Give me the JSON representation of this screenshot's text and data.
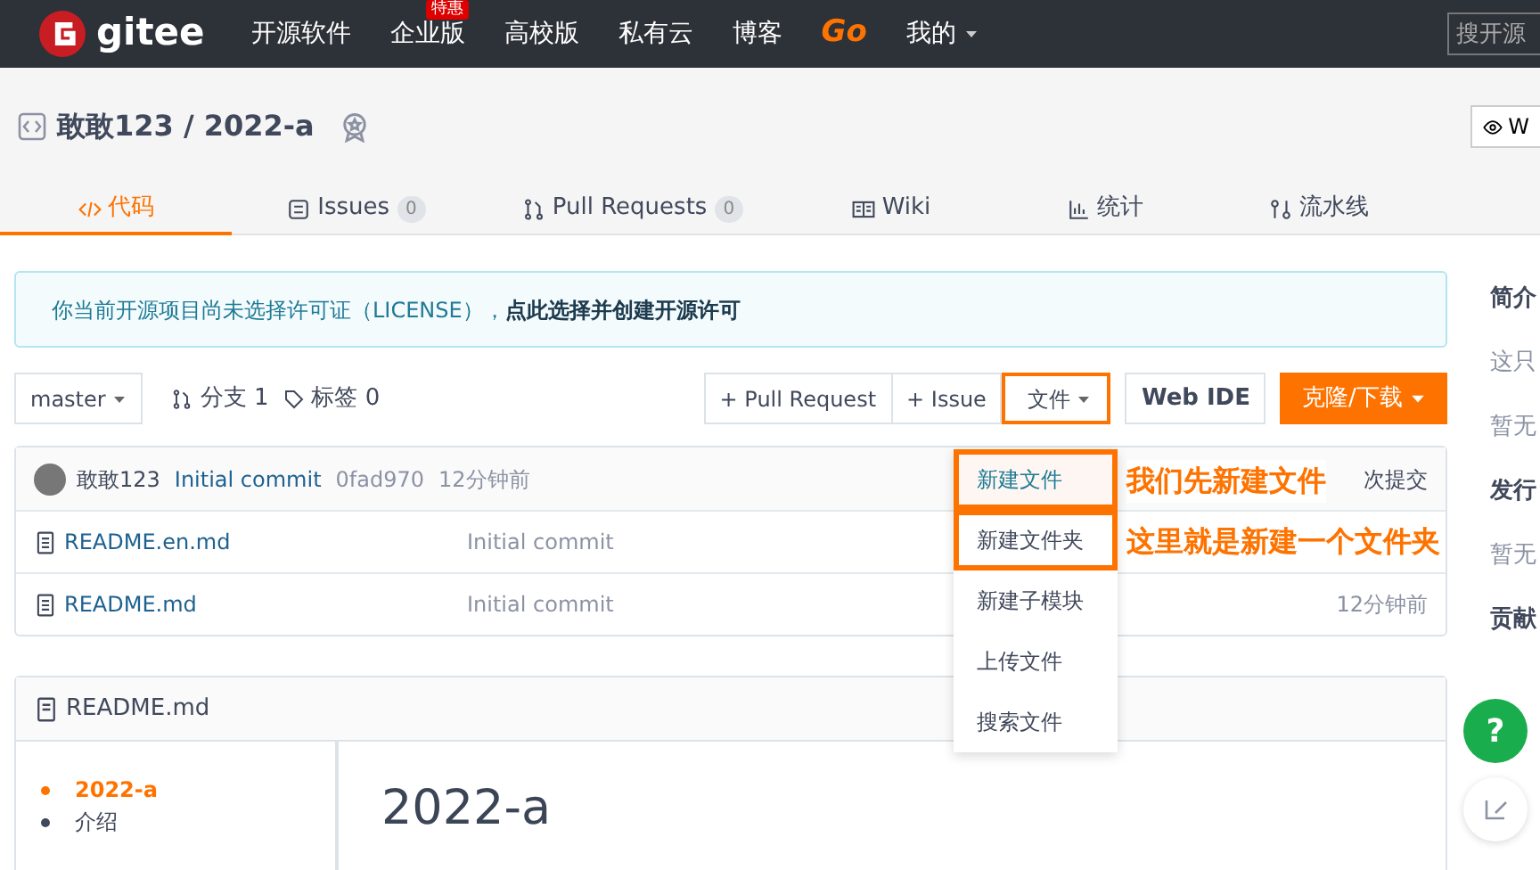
{
  "navbar": {
    "logo": "gitee",
    "items": [
      {
        "label": "开源软件",
        "kind": "plain"
      },
      {
        "label": "企业版",
        "badge": "特惠",
        "kind": "plain"
      },
      {
        "label": "高校版",
        "kind": "plain"
      },
      {
        "label": "私有云",
        "kind": "plain"
      },
      {
        "label": "博客",
        "kind": "plain"
      },
      {
        "label": "Go",
        "kind": "brand"
      },
      {
        "label": "我的",
        "kind": "menu"
      }
    ],
    "search": {
      "placeholder": "搜开源"
    }
  },
  "repo": {
    "title": "敢敢123 / 2022-a",
    "watch_label": "W"
  },
  "tabs": [
    {
      "label": "代码",
      "selected": true
    },
    {
      "label": "Issues",
      "count": "0",
      "selected": false
    },
    {
      "label": "Pull Requests",
      "count": "0",
      "selected": false
    },
    {
      "label": "Wiki",
      "selected": false
    },
    {
      "label": "统计",
      "selected": false
    },
    {
      "label": "流水线",
      "selected": false
    }
  ],
  "notice": "你当前开源项目尚未选择许可证（LICENSE），**点此选择并创建开源许可**",
  "toolbar": {
    "branch": "master",
    "branches": "分支 1",
    "tags": "标签 0",
    "buttons": [
      {
        "label": "+ Pull Request",
        "highlighted": false
      },
      {
        "label": "+ Issue",
        "highlighted": false
      },
      {
        "label": "文件",
        "highlighted": true
      }
    ],
    "web_ide": "Web IDE",
    "clone": "克隆/下载"
  },
  "commit": {
    "author": "敢敢123",
    "message": "Initial commit",
    "hash": "0fad970",
    "time": "12分钟前",
    "count": "次提交"
  },
  "files": [
    {
      "name": "README.en.md",
      "message": "Initial commit"
    },
    {
      "name": "README.md",
      "message": "Initial commit",
      "time": "12分钟前"
    }
  ],
  "file_menu": [
    {
      "label": "新建文件",
      "selected": true,
      "highlighted": true,
      "note": "我们先新建文件"
    },
    {
      "label": "新建文件夹",
      "selected": false,
      "highlighted": true,
      "note": "这里就是新建一个文件夹"
    },
    {
      "label": "新建子模块",
      "selected": false,
      "highlighted": false
    },
    {
      "label": "上传文件",
      "selected": false,
      "highlighted": false
    },
    {
      "label": "搜索文件",
      "selected": false,
      "highlighted": false
    }
  ],
  "readme": {
    "filename": "README.md",
    "toc": [
      {
        "label": "2022-a",
        "selected": true,
        "children": [
          {
            "label": "介绍",
            "selected": false
          }
        ]
      }
    ],
    "heading": "2022-a"
  },
  "sidebar": [
    "简介",
    "这只",
    "暂无",
    "发行",
    "暂无",
    "贡献"
  ],
  "help_button": "?"
}
